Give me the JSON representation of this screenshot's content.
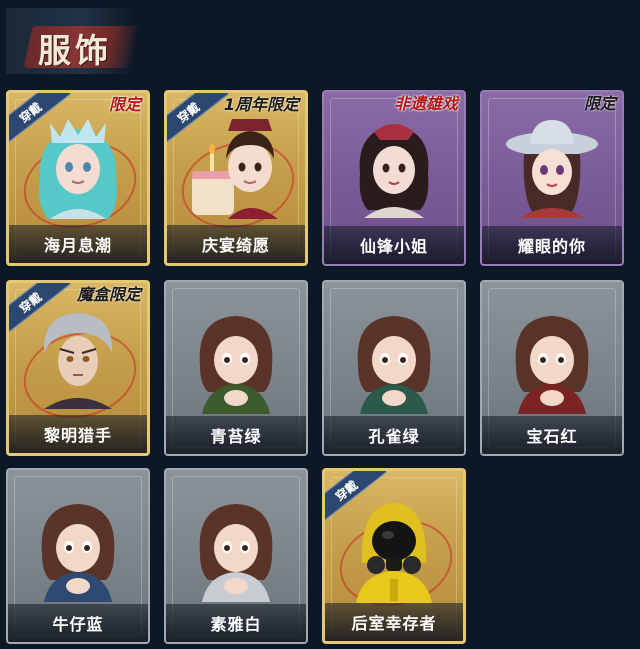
{
  "header": {
    "title": "服饰"
  },
  "worn_label": "穿戴",
  "cards": [
    {
      "name": "海月息潮",
      "tier": "gold",
      "tag": "限定",
      "tag_color": "red",
      "worn": true,
      "portrait": "sea-goddess-portrait"
    },
    {
      "name": "庆宴绮愿",
      "tier": "gold",
      "tag": "1周年限定",
      "tag_color": "black",
      "worn": true,
      "portrait": "birthday-cake-portrait"
    },
    {
      "name": "仙锋小姐",
      "tier": "purple",
      "tag": "非遗雄戏",
      "tag_color": "red",
      "worn": false,
      "portrait": "opera-lady-portrait"
    },
    {
      "name": "耀眼的你",
      "tier": "purple",
      "tag": "限定",
      "tag_color": "black",
      "worn": false,
      "portrait": "cowgirl-portrait"
    },
    {
      "name": "黎明猎手",
      "tier": "gold",
      "tag": "魔盒限定",
      "tag_color": "black",
      "worn": true,
      "portrait": "dawn-hunter-portrait"
    },
    {
      "name": "青苔绿",
      "tier": "gray",
      "tag": "",
      "worn": false,
      "portrait": "girl-green-hoodie-portrait",
      "hoodie": "#3d5c2e"
    },
    {
      "name": "孔雀绿",
      "tier": "gray",
      "tag": "",
      "worn": false,
      "portrait": "girl-teal-hoodie-portrait",
      "hoodie": "#2a5a4a"
    },
    {
      "name": "宝石红",
      "tier": "gray",
      "tag": "",
      "worn": false,
      "portrait": "girl-red-hoodie-portrait",
      "hoodie": "#7a2424"
    },
    {
      "name": "牛仔蓝",
      "tier": "gray",
      "tag": "",
      "worn": false,
      "portrait": "girl-blue-hoodie-portrait",
      "hoodie": "#2e4a72"
    },
    {
      "name": "素雅白",
      "tier": "gray",
      "tag": "",
      "worn": false,
      "portrait": "girl-white-hoodie-portrait",
      "hoodie": "#c9ccd0"
    },
    {
      "name": "后室幸存者",
      "tier": "gold",
      "tag": "",
      "worn": true,
      "portrait": "hazmat-survivor-portrait"
    }
  ],
  "colors": {
    "background": "#0c1826",
    "gold_border": "#e6c874",
    "purple_card": "#7b5c98",
    "gray_card": "#7c848c",
    "ribbon": "#2c4770",
    "limited_tag_red": "#b01818"
  }
}
